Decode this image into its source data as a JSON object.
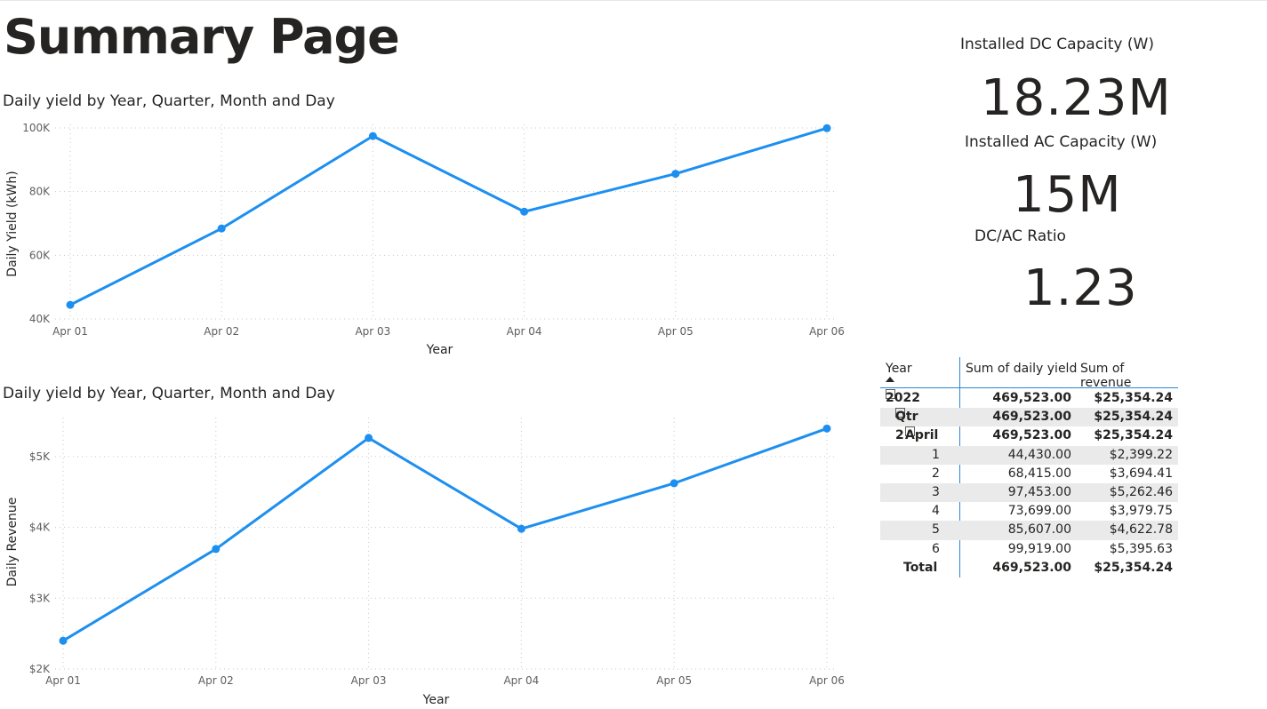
{
  "page": {
    "title": "Summary Page"
  },
  "cards": [
    {
      "label": "Installed DC Capacity (W)",
      "value": "18.23M"
    },
    {
      "label": "Installed AC Capacity (W)",
      "value": "15M"
    },
    {
      "label": "DC/AC Ratio",
      "value": "1.23"
    }
  ],
  "matrix": {
    "headers": {
      "year": "Year",
      "yield": "Sum of daily yield",
      "revenue": "Sum of revenue"
    },
    "rows": [
      {
        "label": "2022",
        "yield": "469,523.00",
        "revenue": "$25,354.24"
      },
      {
        "label": "Qtr 2",
        "yield": "469,523.00",
        "revenue": "$25,354.24"
      },
      {
        "label": "April",
        "yield": "469,523.00",
        "revenue": "$25,354.24"
      },
      {
        "label": "1",
        "yield": "44,430.00",
        "revenue": "$2,399.22"
      },
      {
        "label": "2",
        "yield": "68,415.00",
        "revenue": "$3,694.41"
      },
      {
        "label": "3",
        "yield": "97,453.00",
        "revenue": "$5,262.46"
      },
      {
        "label": "4",
        "yield": "73,699.00",
        "revenue": "$3,979.75"
      },
      {
        "label": "5",
        "yield": "85,607.00",
        "revenue": "$4,622.78"
      },
      {
        "label": "6",
        "yield": "99,919.00",
        "revenue": "$5,395.63"
      },
      {
        "label": "Total",
        "yield": "469,523.00",
        "revenue": "$25,354.24"
      }
    ]
  },
  "colors": {
    "series": "#1d8ff0",
    "accent": "#2b86d8"
  },
  "chart_data": [
    {
      "type": "line",
      "title": "Daily yield by Year, Quarter, Month and Day",
      "xlabel": "Year",
      "ylabel": "Daily Yield (kWh)",
      "categories": [
        "Apr 01",
        "Apr 02",
        "Apr 03",
        "Apr 04",
        "Apr 05",
        "Apr 06"
      ],
      "values": [
        44430,
        68415,
        97453,
        73699,
        85607,
        99919
      ],
      "yticks": [
        "40K",
        "60K",
        "80K",
        "100K"
      ],
      "ylim": [
        40000,
        100000
      ],
      "grid": true
    },
    {
      "type": "line",
      "title": "Daily yield by Year, Quarter, Month and Day",
      "xlabel": "Year",
      "ylabel": "Daily Revenue",
      "categories": [
        "Apr 01",
        "Apr 02",
        "Apr 03",
        "Apr 04",
        "Apr 05",
        "Apr 06"
      ],
      "values": [
        2399.22,
        3694.41,
        5262.46,
        3979.75,
        4622.78,
        5395.63
      ],
      "yticks": [
        "$2K",
        "$3K",
        "$4K",
        "$5K"
      ],
      "ylim": [
        2000,
        5500
      ],
      "grid": true
    }
  ]
}
